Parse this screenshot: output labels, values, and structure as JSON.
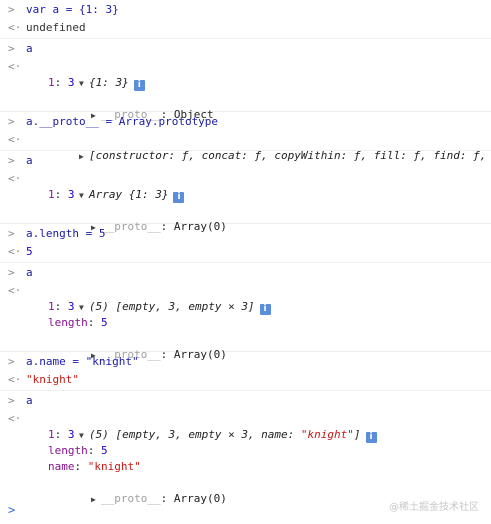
{
  "entries": [
    {
      "in": "var a = {1: 3}",
      "out": "undefined"
    },
    {
      "in": "a",
      "out_obj": {
        "header": "{1: 3}",
        "props": [
          {
            "k": "1",
            "v": "3"
          }
        ],
        "proto": "Object"
      }
    },
    {
      "in": "a.__proto__ = Array.prototype",
      "out_summary": "[constructor: ƒ, concat: ƒ, copyWithin: ƒ, fill: ƒ, find: ƒ, …]"
    },
    {
      "in": "a",
      "out_obj": {
        "prefix": "Array ",
        "header": "{1: 3}",
        "props": [
          {
            "k": "1",
            "v": "3"
          }
        ],
        "proto": "Array(0)"
      }
    },
    {
      "in": "a.length = 5",
      "out": "5"
    },
    {
      "in": "a",
      "out_obj": {
        "prefix": "(5) ",
        "header": "[empty, 3, empty × 3]",
        "props": [
          {
            "k": "1",
            "v": "3"
          },
          {
            "k": "length",
            "v": "5"
          }
        ],
        "proto": "Array(0)"
      }
    },
    {
      "in": "a.name = \"knight\"",
      "out": "\"knight\""
    },
    {
      "in": "a",
      "out_obj": {
        "prefix": "(5) ",
        "header_parts": [
          "[empty, 3, empty × 3, name: ",
          "\"knight\"",
          "]"
        ],
        "props": [
          {
            "k": "1",
            "v": "3"
          },
          {
            "k": "length",
            "v": "5"
          },
          {
            "k": "name",
            "v": "\"knight\""
          }
        ],
        "proto": "Array(0)"
      }
    }
  ],
  "proto_key": "__proto__",
  "watermark": "@稀土掘金技术社区",
  "icons": {
    "input_marker": "chevron-right-icon",
    "output_marker": "chevron-left-icon",
    "expand": "triangle-icon",
    "info": "info-icon"
  },
  "colors": {
    "number": "#1c00cf",
    "string": "#c41a16",
    "key": "#881391",
    "input": "#1a1aa6"
  }
}
